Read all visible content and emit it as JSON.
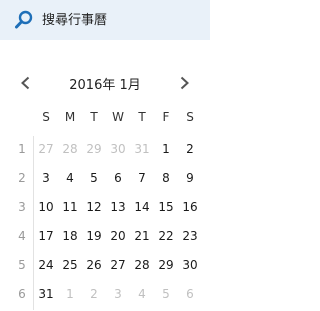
{
  "search": {
    "placeholder": "搜尋行事曆",
    "icon": "search-icon"
  },
  "nav": {
    "prev_icon": "chevron-left-icon",
    "next_icon": "chevron-right-icon",
    "month_label": "2016年 1月"
  },
  "days_of_week": [
    "S",
    "M",
    "T",
    "W",
    "T",
    "F",
    "S"
  ],
  "weeks": [
    {
      "num": "1",
      "days": [
        {
          "d": "27",
          "o": true
        },
        {
          "d": "28",
          "o": true
        },
        {
          "d": "29",
          "o": true
        },
        {
          "d": "30",
          "o": true
        },
        {
          "d": "31",
          "o": true
        },
        {
          "d": "1",
          "o": false
        },
        {
          "d": "2",
          "o": false
        }
      ]
    },
    {
      "num": "2",
      "days": [
        {
          "d": "3",
          "o": false
        },
        {
          "d": "4",
          "o": false
        },
        {
          "d": "5",
          "o": false
        },
        {
          "d": "6",
          "o": false
        },
        {
          "d": "7",
          "o": false
        },
        {
          "d": "8",
          "o": false
        },
        {
          "d": "9",
          "o": false
        }
      ]
    },
    {
      "num": "3",
      "days": [
        {
          "d": "10",
          "o": false
        },
        {
          "d": "11",
          "o": false
        },
        {
          "d": "12",
          "o": false
        },
        {
          "d": "13",
          "o": false
        },
        {
          "d": "14",
          "o": false
        },
        {
          "d": "15",
          "o": false
        },
        {
          "d": "16",
          "o": false
        }
      ]
    },
    {
      "num": "4",
      "days": [
        {
          "d": "17",
          "o": false
        },
        {
          "d": "18",
          "o": false
        },
        {
          "d": "19",
          "o": false
        },
        {
          "d": "20",
          "o": false
        },
        {
          "d": "21",
          "o": false
        },
        {
          "d": "22",
          "o": false
        },
        {
          "d": "23",
          "o": false
        }
      ]
    },
    {
      "num": "5",
      "days": [
        {
          "d": "24",
          "o": false
        },
        {
          "d": "25",
          "o": false
        },
        {
          "d": "26",
          "o": false
        },
        {
          "d": "27",
          "o": false
        },
        {
          "d": "28",
          "o": false
        },
        {
          "d": "29",
          "o": false
        },
        {
          "d": "30",
          "o": false
        }
      ]
    },
    {
      "num": "6",
      "days": [
        {
          "d": "31",
          "o": false
        },
        {
          "d": "1",
          "o": true
        },
        {
          "d": "2",
          "o": true
        },
        {
          "d": "3",
          "o": true
        },
        {
          "d": "4",
          "o": true
        },
        {
          "d": "5",
          "o": true
        },
        {
          "d": "6",
          "o": true
        }
      ]
    }
  ],
  "colors": {
    "search_bg": "#e9f1f9",
    "accent": "#1e6fb8",
    "muted": "#c0c0c0",
    "week_num": "#9a9a9a"
  }
}
